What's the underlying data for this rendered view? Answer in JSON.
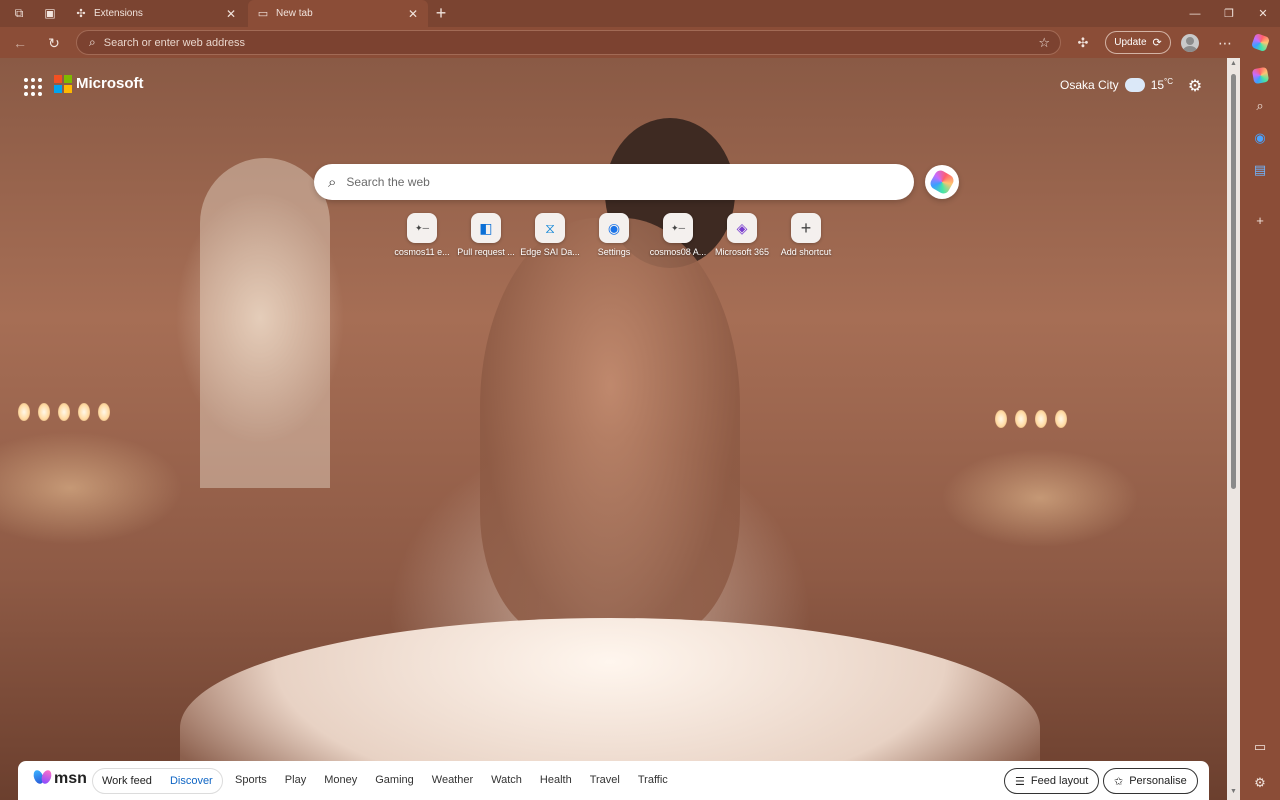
{
  "browser": {
    "tabs": [
      {
        "title": "Extensions",
        "icon": "puzzle-icon"
      },
      {
        "title": "New tab",
        "icon": "newtab-icon",
        "active": true
      }
    ],
    "address_placeholder": "Search or enter web address",
    "update_label": "Update"
  },
  "page": {
    "brand": "Microsoft",
    "weather": {
      "city": "Osaka City",
      "temp": "15",
      "unit": "°C"
    },
    "search_placeholder": "Search the web",
    "shortcuts": [
      {
        "label": "cosmos11 e...",
        "icon": "site-icon"
      },
      {
        "label": "Pull request ...",
        "icon": "azure-devops-icon"
      },
      {
        "label": "Edge SAI Da...",
        "icon": "edge-sai-icon"
      },
      {
        "label": "Settings",
        "icon": "edge-settings-icon"
      },
      {
        "label": "cosmos08 A...",
        "icon": "site-icon"
      },
      {
        "label": "Microsoft 365",
        "icon": "m365-icon"
      },
      {
        "label": "Add shortcut",
        "icon": "plus-icon"
      }
    ]
  },
  "msn": {
    "logo": "msn",
    "feed_tabs": [
      "Work feed",
      "Discover"
    ],
    "active_feed": "Discover",
    "links": [
      "Sports",
      "Play",
      "Money",
      "Gaming",
      "Weather",
      "Watch",
      "Health",
      "Travel",
      "Traffic"
    ],
    "feed_layout_label": "Feed layout",
    "personalise_label": "Personalise"
  },
  "colors": {
    "frame": "#7b4431",
    "toolbar": "#8b4d37",
    "link_active": "#1066c4"
  }
}
